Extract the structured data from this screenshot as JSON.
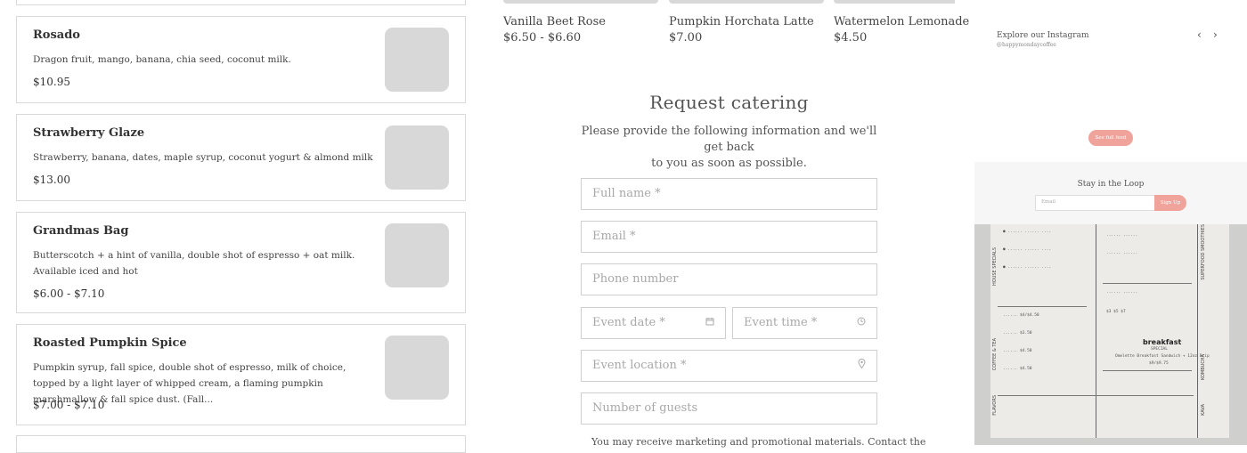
{
  "menu_items": [
    {
      "name": "",
      "description": "",
      "price": ""
    },
    {
      "name": "Rosado",
      "description": "Dragon fruit, mango, banana, chia seed, coconut milk.",
      "price": "$10.95"
    },
    {
      "name": "Strawberry Glaze",
      "description": "Strawberry, banana, dates, maple syrup, coconut yogurt & almond milk",
      "price": "$13.00"
    },
    {
      "name": "Grandmas Bag",
      "description": "Butterscotch + a hint of vanilla, double shot of espresso + oat milk. Available iced and hot",
      "price": "$6.00 - $7.10"
    },
    {
      "name": "Roasted Pumpkin Spice",
      "description": "Pumpkin syrup, fall spice, double shot of espresso, milk of choice, topped by a light layer of whipped cream, a flaming pumpkin marshmallow & fall spice dust. (Fall...",
      "price": "$7.00 - $7.10"
    }
  ],
  "products": [
    {
      "name": "Vanilla Beet Rose",
      "price": "$6.50 - $6.60"
    },
    {
      "name": "Pumpkin Horchata Latte",
      "price": "$7.00"
    },
    {
      "name": "Watermelon Lemonade",
      "price": "$4.50"
    }
  ],
  "catering": {
    "title": "Request catering",
    "subtitle_line1": "Please provide the following information and we'll get back",
    "subtitle_line2": "to you as soon as possible.",
    "fields": {
      "full_name": "Full name *",
      "email": "Email *",
      "phone": "Phone number",
      "event_date": "Event date *",
      "event_time": "Event time *",
      "event_location": "Event location *",
      "guests": "Number of guests"
    },
    "disclaimer": "You may receive marketing and promotional materials. Contact the"
  },
  "instagram": {
    "title": "Explore our Instagram",
    "handle": "@happymondaycoffee",
    "prev_icon": "chevron-left-icon",
    "next_icon": "chevron-right-icon",
    "feed_button": "See full feed",
    "loop_title": "Stay in the Loop",
    "email_placeholder": "Email",
    "signup_button": "Sign Up",
    "photo_text": {
      "breakfast": "breakfast",
      "special": "SPECIAL",
      "sandwich": "Omelette Breakfast Sandwich + 12oz Drip",
      "sandwich_price": "$9/$9.75",
      "side_left_1": "COFFEE & TEA",
      "side_left_2": "FLAVORS",
      "side_left_3": "HOUSE SPECIALS",
      "side_right_1": "SUPERFOOD SMOOTHIES",
      "side_right_2": "KOMBUCHA",
      "side_right_3": "KAVA"
    }
  },
  "colors": {
    "accent": "#f0a39b",
    "placeholder_image": "#d8d8d8",
    "border": "#d9d9d9"
  }
}
